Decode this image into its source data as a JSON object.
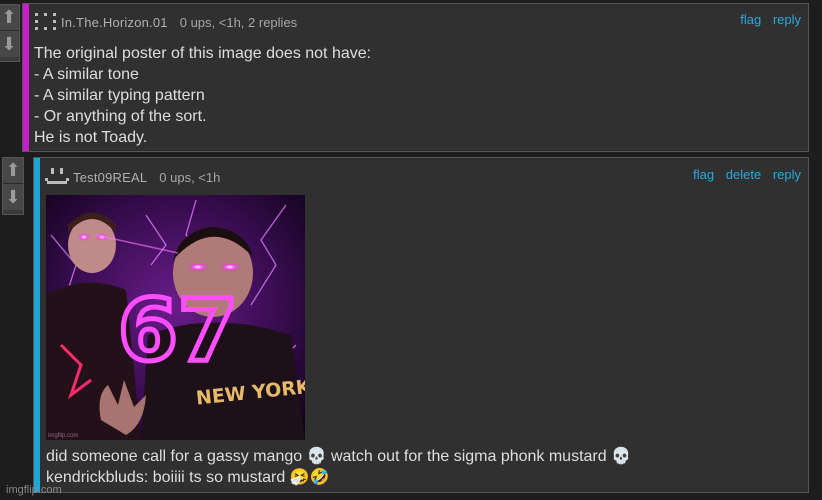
{
  "comment1": {
    "username": "In.The.Horizon.01",
    "stats": "0 ups, <1h, 2 replies",
    "actions": [
      "flag",
      "reply"
    ],
    "lines": [
      "The original poster of this image does not have:",
      "- A similar tone",
      "- A similar typing pattern",
      "- Or anything of the sort.",
      "He is not Toady."
    ],
    "accent_color": "#c81ec8"
  },
  "comment2": {
    "username": "Test09REAL",
    "stats": "0 ups, <1h",
    "actions": [
      "flag",
      "delete",
      "reply"
    ],
    "image": {
      "big_text": "67",
      "shirt_text": "NEW YORK",
      "watermark": "imgflip.com"
    },
    "lines": [
      "did someone call for a gassy mango 💀 watch out for the sigma phonk mustard 💀",
      "kendrickbluds: boiiii ts so mustard 🤧🤣"
    ],
    "accent_color": "#1da6dc"
  },
  "footer_watermark": "imgflip.com",
  "icons": {
    "upvote": "up-arrow-icon",
    "downvote": "down-arrow-icon"
  }
}
